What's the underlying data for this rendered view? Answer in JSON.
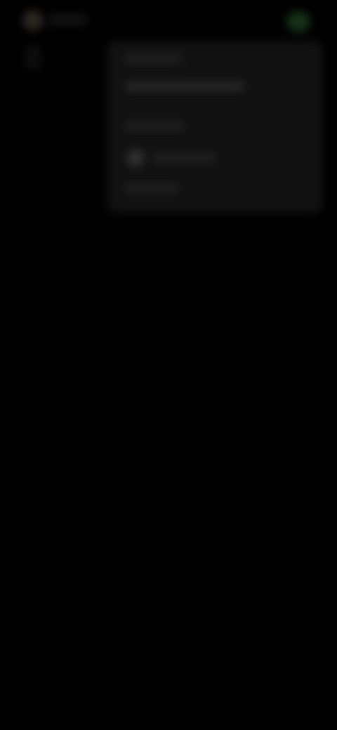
{
  "header": {
    "app_label": "",
    "status_label": ""
  },
  "menu": {
    "items": [
      {
        "label": ""
      },
      {
        "label": ""
      },
      {
        "label": ""
      },
      {
        "label": ""
      },
      {
        "label": ""
      }
    ]
  },
  "colors": {
    "background": "#000000",
    "panel": "#111111",
    "status_indicator": "#143218"
  },
  "icons": {
    "top_left": "app-icon",
    "top_right": "status-indicator-icon",
    "menu_item_avatar": "avatar-icon"
  }
}
